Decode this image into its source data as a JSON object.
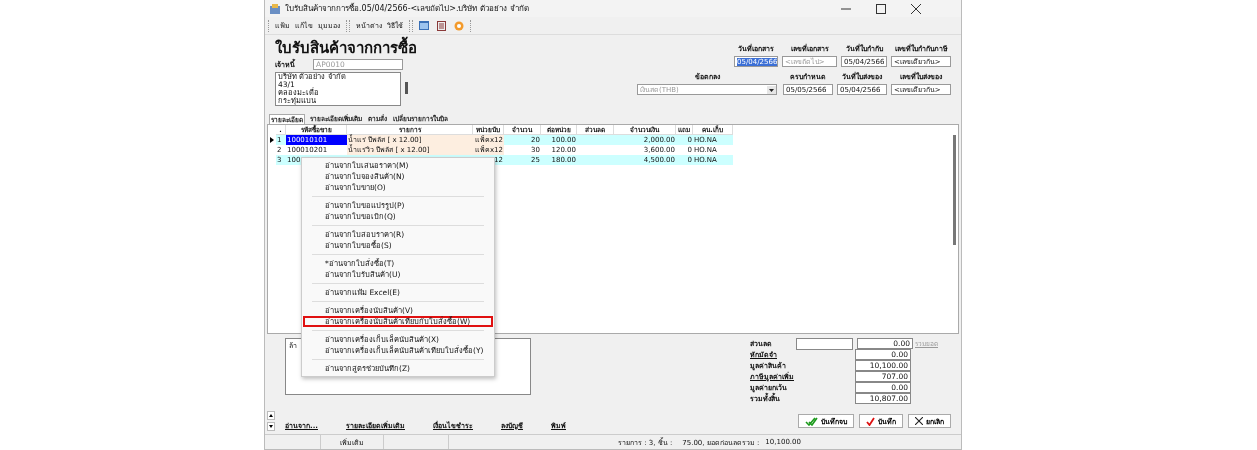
{
  "window": {
    "title": "ใบรับสินค้าจากการซื้อ.05/04/2566-<เลขถัดไป>.บริษัท ตัวอย่าง จำกัด"
  },
  "menu_groups": [
    [
      "แฟ้ม",
      "แก้ไข",
      "มุมมอง"
    ],
    [
      "หน้าต่าง",
      "วิธีใช้"
    ]
  ],
  "heading": "ใบรับสินค้าจากการซื้อ",
  "creditor": {
    "label": "เจ้าหนี้",
    "value": "AP0010",
    "disabled": true
  },
  "address": [
    "บริษัท ตัวอย่าง จำกัด",
    "43/1",
    "คลองมะเดื่อ",
    "กระทุ่มแบน"
  ],
  "header_fields_row1": [
    {
      "label": "วันที่เอกสาร",
      "value": "05/04/2566",
      "selected": true
    },
    {
      "label": "เลขที่เอกสาร",
      "placeholder": "<เลขถัดไป>",
      "selected": false
    },
    {
      "label": "วันที่ใบกำกับ",
      "value": "05/04/2566",
      "selected": false
    },
    {
      "label": "เลขที่ใบกำกับภาษี",
      "value": "<เลขเดียวกัน>",
      "selected": false
    }
  ],
  "terms": {
    "label": "ข้อตกลง",
    "value": "เงินสด(THB)"
  },
  "header_fields_row2": [
    {
      "label": "ครบกำหนด",
      "value": "05/05/2566",
      "selected": false
    },
    {
      "label": "วันที่ใบส่งของ",
      "value": "05/04/2566",
      "selected": false
    },
    {
      "label": "เลขที่ใบส่งของ",
      "value": "<เลขเดียวกัน>",
      "selected": false
    }
  ],
  "tabs": [
    {
      "label": "รายละเอียด",
      "selected": true
    },
    {
      "label": "รายละเอียดเพิ่มเติม",
      "selected": false
    },
    {
      "label": "ตามสั่ง",
      "selected": false
    },
    {
      "label": "เปลี่ยนรายการในบิล",
      "selected": false
    }
  ],
  "table": {
    "columns": [
      ".",
      "รหัสซื้อขาย",
      "รายการ",
      "หน่วยนับ",
      "จำนวน",
      "ต่อหน่วย",
      "ส่วนลด",
      "จำนวนเงิน",
      "แถม",
      "คน.เก็บ"
    ],
    "rows": [
      {
        "selected": true,
        "cells": [
          "1",
          "100010101",
          "น้ำแร่ ปีพลัส [ x 12.00]",
          "แพ็คx12",
          "20",
          "100.00",
          "",
          "2,000.00",
          "0",
          "HO.NA"
        ]
      },
      {
        "selected": false,
        "cells": [
          "2",
          "100010201",
          "น้ำแร่วิว ปีพลัส [ x 12.00]",
          "แพ็คx12",
          "30",
          "120.00",
          "",
          "3,600.00",
          "0",
          "HO.NA"
        ]
      },
      {
        "selected": false,
        "cells": [
          "3",
          "100",
          "",
          "12",
          "25",
          "180.00",
          "",
          "4,500.00",
          "0",
          "HO.NA"
        ]
      }
    ]
  },
  "context_menu": [
    [
      {
        "label": "อ่านจากใบเสนอราคา(M)",
        "selected": false
      },
      {
        "label": "อ่านจากใบจองสินค้า(N)",
        "selected": false
      },
      {
        "label": "อ่านจากใบขาย(O)",
        "selected": false
      }
    ],
    [
      {
        "label": "อ่านจากใบขอแปรรูป(P)",
        "selected": false
      },
      {
        "label": "อ่านจากใบขอเบิก(Q)",
        "selected": false
      }
    ],
    [
      {
        "label": "อ่านจากใบสอบราคา(R)",
        "selected": false
      },
      {
        "label": "อ่านจากใบขอซื้อ(S)",
        "selected": false
      }
    ],
    [
      {
        "label": "*อ่านจากใบสั่งซื้อ(T)",
        "selected": false
      },
      {
        "label": "อ่านจากใบรับสินค้า(U)",
        "selected": false
      }
    ],
    [
      {
        "label": "อ่านจากแฟ้ม Excel(E)",
        "selected": false
      }
    ],
    [
      {
        "label": "อ่านจากเครื่องนับสินค้า(V)",
        "selected": false
      },
      {
        "label": "อ่านจากเครื่องนับสินค้าเทียบกับใบสั่งซื้อ(W)",
        "selected": true
      }
    ],
    [
      {
        "label": "อ่านจากเครื่องเก็บเล็คนับสินค้า(X)",
        "selected": false
      },
      {
        "label": "อ่านจากเครื่องเก็บเล็คนับสินค้าเทียบใบสั่งซื้อ(Y)",
        "selected": false
      }
    ],
    [
      {
        "label": "อ่านจากสูตรช่วยบันทึก(Z)",
        "selected": false
      }
    ]
  ],
  "note": "ล้า",
  "discount": {
    "label": "ส่วนลด",
    "value": "0.00",
    "link": "รวมยอด"
  },
  "totals": [
    {
      "label": "หักมัดจำ",
      "value": "0.00",
      "kind": "link"
    },
    {
      "label": "มูลค่าสินค้า",
      "value": "10,100.00",
      "kind": "text"
    },
    {
      "label": "ภาษีมูลค่าเพิ่ม",
      "value": "707.00",
      "kind": "link"
    },
    {
      "label": "มูลค่ายกเว้น",
      "value": "0.00",
      "kind": "text"
    },
    {
      "label": "รวมทั้งสิ้น",
      "value": "10,807.00",
      "kind": "text"
    }
  ],
  "links": [
    "อ่านจาก...",
    "รายละเอียดเพิ่มเติม",
    "เงื่อนไขชำระ",
    "ลงบัญชี",
    "พิมพ์"
  ],
  "buttons": [
    {
      "label": "บันทึกจบ",
      "kind": "double_check"
    },
    {
      "label": "บันทึก",
      "kind": "check"
    },
    {
      "label": "ยกเลิก",
      "kind": "cancel"
    }
  ],
  "status_bar": {
    "left": "เพิ่มเติม",
    "items": "รายการ : 3, ชิ้น :",
    "pieces": "75.00, ยอดก่อนลดรวม :",
    "total": "10,100.00"
  }
}
